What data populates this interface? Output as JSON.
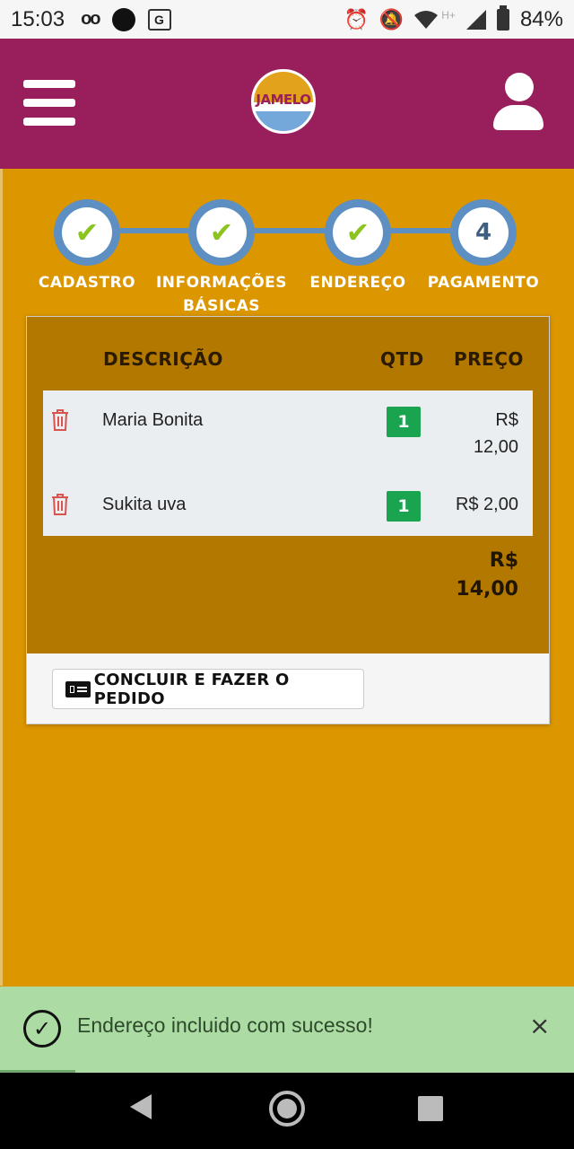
{
  "status_bar": {
    "time": "15:03",
    "voicemail_icon": "voicemail-icon",
    "notification_dot": "circle-icon",
    "translate_icon": "translate-icon",
    "translate_glyph": "G",
    "alarm_icon": "alarm-icon",
    "mute_icon": "bell-off-icon",
    "wifi_icon": "wifi-icon",
    "network_label": "H+",
    "signal_icon": "signal-icon",
    "battery_icon": "battery-icon",
    "battery": "84%"
  },
  "header": {
    "brand_color": "#981f5c",
    "logo_text": "JAMELO"
  },
  "stepper": {
    "steps": [
      {
        "label": "CADASTRO",
        "state": "done"
      },
      {
        "label": "INFORMAÇÕES BÁSICAS",
        "state": "done"
      },
      {
        "label": "ENDEREÇO",
        "state": "done"
      },
      {
        "label": "PAGAMENTO",
        "state": "current",
        "number": "4"
      }
    ]
  },
  "cart": {
    "headers": {
      "description": "DESCRIÇÃO",
      "qty": "QTD",
      "price": "PREÇO"
    },
    "items": [
      {
        "description": "Maria Bonita",
        "qty": "1",
        "price": "R$ 12,00"
      },
      {
        "description": "Sukita uva",
        "qty": "1",
        "price": "R$ 2,00"
      }
    ],
    "total": "R$ 14,00",
    "submit_label": "CONCLUIR E FAZER O PEDIDO"
  },
  "toast": {
    "message": "Endereço incluido com sucesso!",
    "close_symbol": "×",
    "check_symbol": "✓"
  },
  "colors": {
    "page_background": "#db9600",
    "card_top": "#b27800",
    "stepper_blue": "#5d8fc2",
    "check_green": "#8cc31e",
    "qty_badge": "#1aa44f",
    "toast_background": "#acdca3",
    "trash_red": "#d9534f"
  }
}
